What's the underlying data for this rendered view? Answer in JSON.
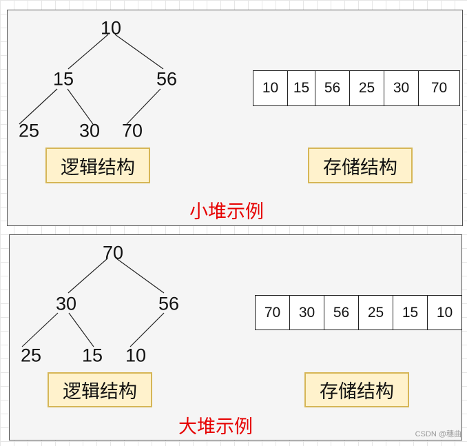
{
  "min_heap": {
    "root": "10",
    "left": "15",
    "right": "56",
    "left_left": "25",
    "left_right": "30",
    "right_left": "70",
    "array": [
      "10",
      "15",
      "56",
      "25",
      "30",
      "70"
    ],
    "logical_label": "逻辑结构",
    "storage_label": "存储结构",
    "caption": "小堆示例"
  },
  "max_heap": {
    "root": "70",
    "left": "30",
    "right": "56",
    "left_left": "25",
    "left_right": "15",
    "right_left": "10",
    "array": [
      "70",
      "30",
      "56",
      "25",
      "15",
      "10"
    ],
    "logical_label": "逻辑结构",
    "storage_label": "存储结构",
    "caption": "大堆示例"
  },
  "watermark": "CSDN @穗曲",
  "colors": {
    "panel_bg": "#f5f5f5",
    "label_fill": "#fff2cc",
    "label_border": "#d6b656",
    "caption": "#e60000"
  }
}
